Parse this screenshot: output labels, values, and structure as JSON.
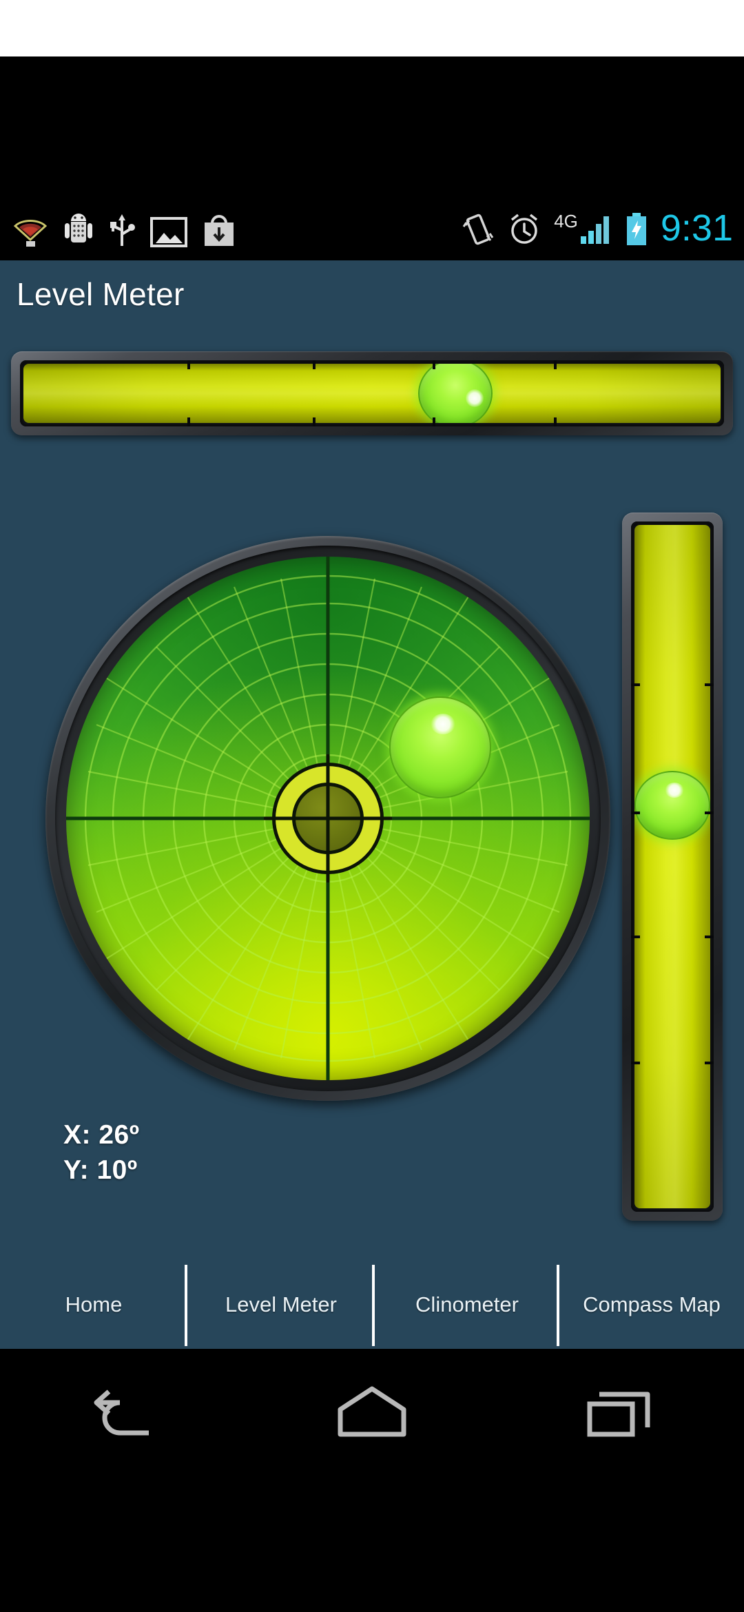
{
  "status_bar": {
    "time": "9:31",
    "left_icons": [
      {
        "name": "wifi-signal-icon",
        "label": "wifi"
      },
      {
        "name": "android-robot-icon",
        "label": "android"
      },
      {
        "name": "usb-icon",
        "label": "usb"
      },
      {
        "name": "image-icon",
        "label": "screenshot"
      },
      {
        "name": "download-bag-icon",
        "label": "download"
      }
    ],
    "right_icons": [
      {
        "name": "vibrate-icon",
        "label": "vibrate"
      },
      {
        "name": "alarm-clock-icon",
        "label": "alarm"
      },
      {
        "name": "signal-4g-icon",
        "label": "4G"
      },
      {
        "name": "battery-charging-icon",
        "label": "battery charging"
      }
    ],
    "network_label": "4G",
    "time_color": "#1ec8e8"
  },
  "app": {
    "title": "Level Meter",
    "background_color": "#27465a"
  },
  "levels": {
    "horizontal": {
      "name": "horizontal-bubble-level",
      "bubble_position_percent": 69.5,
      "vial_color": "#d9e800",
      "bubble_color": "#8ae82a",
      "tick_count": 5
    },
    "vertical": {
      "name": "vertical-bubble-level",
      "bubble_position_percent": 41.0,
      "vial_color": "#dcec00",
      "bubble_color": "#8ae82a",
      "tick_count": 4
    },
    "circular": {
      "name": "circular-bubble-level",
      "bubble_offset_x_percent": 21.0,
      "bubble_offset_y_percent": -13.0,
      "face_color_top": "#1f8c22",
      "face_color_bottom": "#cbe800",
      "bubble_color": "#8ae82a",
      "target_ring_color": "#d8e52a"
    }
  },
  "readout": {
    "x_label": "X: 26º",
    "y_label": "Y: 10º",
    "x_value": 26,
    "y_value": 10,
    "unit": "º"
  },
  "tabs": [
    {
      "label": "Home",
      "name": "tab-home",
      "selected": false
    },
    {
      "label": "Level Meter",
      "name": "tab-level-meter",
      "selected": true
    },
    {
      "label": "Clinometer",
      "name": "tab-clinometer",
      "selected": false
    },
    {
      "label": "Compass Map",
      "name": "tab-compass-map",
      "selected": false
    }
  ],
  "nav_bar": {
    "buttons": [
      {
        "name": "nav-back-button",
        "label": "Back"
      },
      {
        "name": "nav-home-button",
        "label": "Home"
      },
      {
        "name": "nav-recents-button",
        "label": "Recents"
      }
    ]
  }
}
